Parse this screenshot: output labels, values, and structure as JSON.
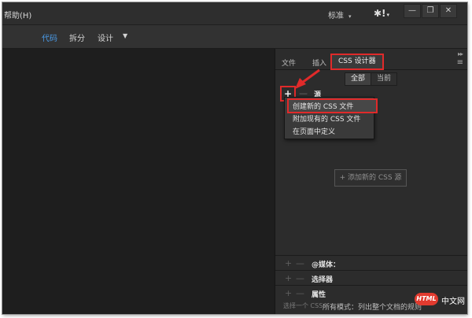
{
  "titlebar": {
    "help_menu": "帮助(H)",
    "preset": "标准",
    "preset_caret": "▾",
    "gear": "✱!",
    "gear_caret": "▾",
    "win_minimize": "—",
    "win_restore": "❐",
    "win_close": "✕"
  },
  "viewbar": {
    "code": "代码",
    "split": "拆分",
    "design": "设计",
    "design_caret": "▼"
  },
  "panel": {
    "tabs": [
      "文件",
      "插入",
      "CSS 设计器"
    ],
    "dots": "▸▸",
    "menu_icon": "≡",
    "filter_all": "全部",
    "filter_current": "当前",
    "plus": "+",
    "minus": "—",
    "sources_label": "源",
    "dropdown": [
      "创建新的 CSS 文件",
      "附加现有的 CSS 文件",
      "在页面中定义"
    ],
    "add_source": "+ 添加新的 CSS 源",
    "sections": [
      "@媒体：",
      "选择器",
      "属性"
    ],
    "hint_left": "选择一个 CSS",
    "hint_right": "所有模式：列出整个文档的规则"
  },
  "watermark": {
    "badge": "HTML",
    "site": "中文网"
  },
  "colors": {
    "highlight": "#e02a2a",
    "active_view": "#4a9be8"
  }
}
